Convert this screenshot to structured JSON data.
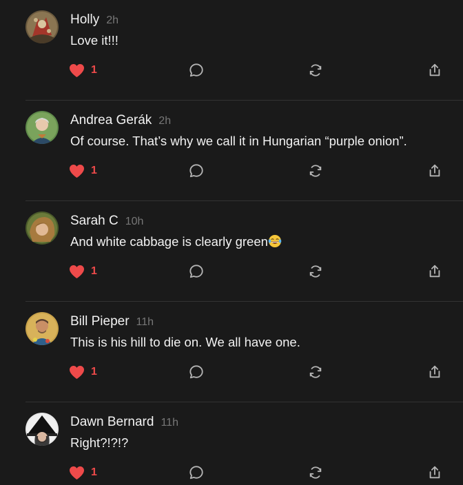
{
  "colors": {
    "background": "#1a1a1a",
    "text": "#f2f2f2",
    "muted": "#777777",
    "like": "#ee4a4a",
    "icon": "#b5b5b5",
    "divider": "#333333"
  },
  "comments": [
    {
      "author": "Holly",
      "time": "2h",
      "text": "Love it!!!",
      "likes": "1",
      "liked": true,
      "avatar_icon": "avatar-holly"
    },
    {
      "author": "Andrea Gerák",
      "time": "2h",
      "text": "Of course. That’s why we call it in Hungarian “purple onion”.",
      "likes": "1",
      "liked": true,
      "avatar_icon": "avatar-andrea"
    },
    {
      "author": "Sarah C",
      "time": "10h",
      "text": "And white cabbage is clearly green",
      "emoji": "laughing-crying-emoji",
      "likes": "1",
      "liked": true,
      "avatar_icon": "avatar-sarah"
    },
    {
      "author": "Bill Pieper",
      "time": "11h",
      "text": "This is his hill to die on. We all have one.",
      "likes": "1",
      "liked": true,
      "avatar_icon": "avatar-bill"
    },
    {
      "author": "Dawn Bernard",
      "time": "11h",
      "text": "Right?!?!?",
      "likes": "1",
      "liked": true,
      "avatar_icon": "avatar-dawn"
    }
  ]
}
